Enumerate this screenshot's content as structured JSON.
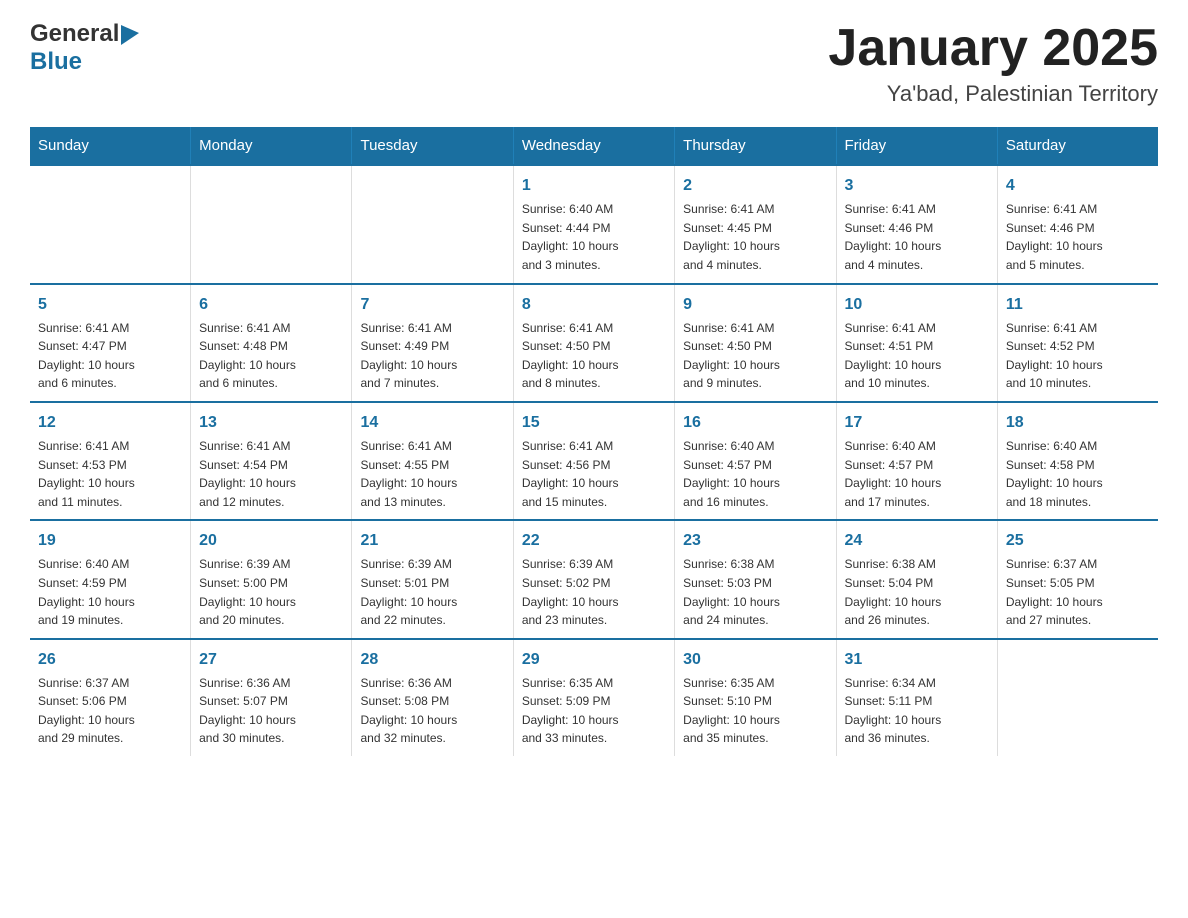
{
  "header": {
    "title": "January 2025",
    "subtitle": "Ya'bad, Palestinian Territory",
    "logo_general": "General",
    "logo_blue": "Blue"
  },
  "days_of_week": [
    "Sunday",
    "Monday",
    "Tuesday",
    "Wednesday",
    "Thursday",
    "Friday",
    "Saturday"
  ],
  "weeks": [
    [
      {
        "day": "",
        "info": ""
      },
      {
        "day": "",
        "info": ""
      },
      {
        "day": "",
        "info": ""
      },
      {
        "day": "1",
        "info": "Sunrise: 6:40 AM\nSunset: 4:44 PM\nDaylight: 10 hours\nand 3 minutes."
      },
      {
        "day": "2",
        "info": "Sunrise: 6:41 AM\nSunset: 4:45 PM\nDaylight: 10 hours\nand 4 minutes."
      },
      {
        "day": "3",
        "info": "Sunrise: 6:41 AM\nSunset: 4:46 PM\nDaylight: 10 hours\nand 4 minutes."
      },
      {
        "day": "4",
        "info": "Sunrise: 6:41 AM\nSunset: 4:46 PM\nDaylight: 10 hours\nand 5 minutes."
      }
    ],
    [
      {
        "day": "5",
        "info": "Sunrise: 6:41 AM\nSunset: 4:47 PM\nDaylight: 10 hours\nand 6 minutes."
      },
      {
        "day": "6",
        "info": "Sunrise: 6:41 AM\nSunset: 4:48 PM\nDaylight: 10 hours\nand 6 minutes."
      },
      {
        "day": "7",
        "info": "Sunrise: 6:41 AM\nSunset: 4:49 PM\nDaylight: 10 hours\nand 7 minutes."
      },
      {
        "day": "8",
        "info": "Sunrise: 6:41 AM\nSunset: 4:50 PM\nDaylight: 10 hours\nand 8 minutes."
      },
      {
        "day": "9",
        "info": "Sunrise: 6:41 AM\nSunset: 4:50 PM\nDaylight: 10 hours\nand 9 minutes."
      },
      {
        "day": "10",
        "info": "Sunrise: 6:41 AM\nSunset: 4:51 PM\nDaylight: 10 hours\nand 10 minutes."
      },
      {
        "day": "11",
        "info": "Sunrise: 6:41 AM\nSunset: 4:52 PM\nDaylight: 10 hours\nand 10 minutes."
      }
    ],
    [
      {
        "day": "12",
        "info": "Sunrise: 6:41 AM\nSunset: 4:53 PM\nDaylight: 10 hours\nand 11 minutes."
      },
      {
        "day": "13",
        "info": "Sunrise: 6:41 AM\nSunset: 4:54 PM\nDaylight: 10 hours\nand 12 minutes."
      },
      {
        "day": "14",
        "info": "Sunrise: 6:41 AM\nSunset: 4:55 PM\nDaylight: 10 hours\nand 13 minutes."
      },
      {
        "day": "15",
        "info": "Sunrise: 6:41 AM\nSunset: 4:56 PM\nDaylight: 10 hours\nand 15 minutes."
      },
      {
        "day": "16",
        "info": "Sunrise: 6:40 AM\nSunset: 4:57 PM\nDaylight: 10 hours\nand 16 minutes."
      },
      {
        "day": "17",
        "info": "Sunrise: 6:40 AM\nSunset: 4:57 PM\nDaylight: 10 hours\nand 17 minutes."
      },
      {
        "day": "18",
        "info": "Sunrise: 6:40 AM\nSunset: 4:58 PM\nDaylight: 10 hours\nand 18 minutes."
      }
    ],
    [
      {
        "day": "19",
        "info": "Sunrise: 6:40 AM\nSunset: 4:59 PM\nDaylight: 10 hours\nand 19 minutes."
      },
      {
        "day": "20",
        "info": "Sunrise: 6:39 AM\nSunset: 5:00 PM\nDaylight: 10 hours\nand 20 minutes."
      },
      {
        "day": "21",
        "info": "Sunrise: 6:39 AM\nSunset: 5:01 PM\nDaylight: 10 hours\nand 22 minutes."
      },
      {
        "day": "22",
        "info": "Sunrise: 6:39 AM\nSunset: 5:02 PM\nDaylight: 10 hours\nand 23 minutes."
      },
      {
        "day": "23",
        "info": "Sunrise: 6:38 AM\nSunset: 5:03 PM\nDaylight: 10 hours\nand 24 minutes."
      },
      {
        "day": "24",
        "info": "Sunrise: 6:38 AM\nSunset: 5:04 PM\nDaylight: 10 hours\nand 26 minutes."
      },
      {
        "day": "25",
        "info": "Sunrise: 6:37 AM\nSunset: 5:05 PM\nDaylight: 10 hours\nand 27 minutes."
      }
    ],
    [
      {
        "day": "26",
        "info": "Sunrise: 6:37 AM\nSunset: 5:06 PM\nDaylight: 10 hours\nand 29 minutes."
      },
      {
        "day": "27",
        "info": "Sunrise: 6:36 AM\nSunset: 5:07 PM\nDaylight: 10 hours\nand 30 minutes."
      },
      {
        "day": "28",
        "info": "Sunrise: 6:36 AM\nSunset: 5:08 PM\nDaylight: 10 hours\nand 32 minutes."
      },
      {
        "day": "29",
        "info": "Sunrise: 6:35 AM\nSunset: 5:09 PM\nDaylight: 10 hours\nand 33 minutes."
      },
      {
        "day": "30",
        "info": "Sunrise: 6:35 AM\nSunset: 5:10 PM\nDaylight: 10 hours\nand 35 minutes."
      },
      {
        "day": "31",
        "info": "Sunrise: 6:34 AM\nSunset: 5:11 PM\nDaylight: 10 hours\nand 36 minutes."
      },
      {
        "day": "",
        "info": ""
      }
    ]
  ]
}
